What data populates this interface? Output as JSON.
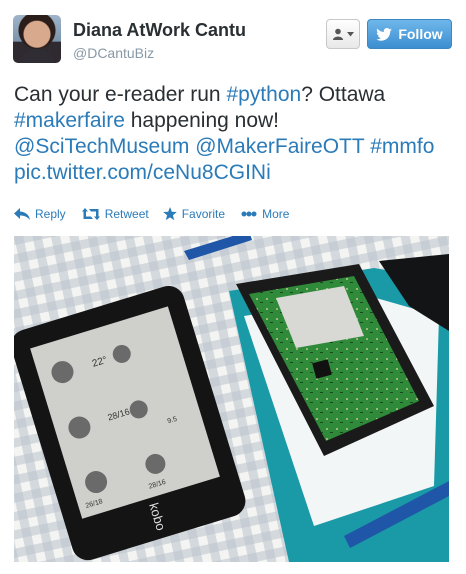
{
  "tweet": {
    "author_name": "Diana AtWork Cantu",
    "author_handle": "@DCantuBiz",
    "follow_label": "Follow",
    "text_parts": [
      {
        "text": "Can your e-reader run ",
        "link": false
      },
      {
        "text": "#python",
        "link": true
      },
      {
        "text": "? Ottawa ",
        "link": false
      },
      {
        "text": "#makerfaire",
        "link": true
      },
      {
        "text": " happening now! ",
        "link": false
      },
      {
        "text": "@SciTechMuseum",
        "link": true
      },
      {
        "text": " ",
        "link": false
      },
      {
        "text": "@MakerFaireOTT",
        "link": true
      },
      {
        "text": " ",
        "link": false
      },
      {
        "text": "#mmfo",
        "link": true
      },
      {
        "text": " ",
        "link": false
      },
      {
        "text": "pic.twitter.com/ceNu8CGINi",
        "link": true
      }
    ],
    "actions": {
      "reply": "Reply",
      "retweet": "Retweet",
      "favorite": "Favorite",
      "more": "More"
    },
    "photo": {
      "brand_text": "kobo",
      "screen_temps": [
        "22°",
        "28/16",
        "26/18",
        "28/16",
        "9.5"
      ]
    }
  },
  "colors": {
    "link": "#2b7bb9",
    "text": "#292f33",
    "muted": "#8899a6",
    "follow_button": "#3c8ed1"
  },
  "icons": [
    "user-dropdown-icon",
    "twitter-bird-icon",
    "reply-icon",
    "retweet-icon",
    "favorite-star-icon",
    "more-dots-icon"
  ]
}
